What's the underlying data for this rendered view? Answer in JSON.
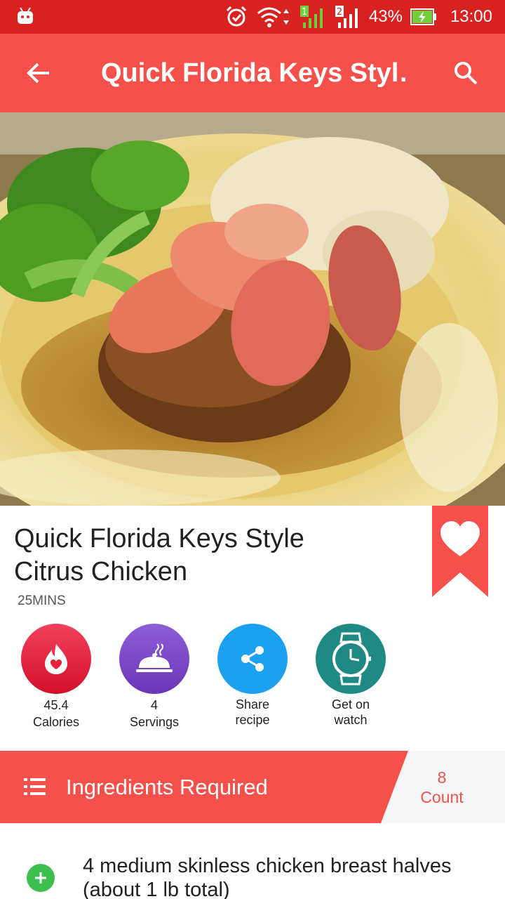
{
  "status_bar": {
    "battery": "43%",
    "time": "13:00",
    "sim1": "1",
    "sim2": "2",
    "icons": [
      "android-icon",
      "alarm-icon",
      "wifi-icon",
      "signal-icon",
      "battery-charging-icon"
    ]
  },
  "app_bar": {
    "title": "Quick Florida Keys Styl…",
    "back_icon": "arrow-back-icon",
    "search_icon": "search-icon"
  },
  "recipe": {
    "title_line1": "Quick Florida Keys Style",
    "title_line2": "Citrus Chicken",
    "time": "25MINS"
  },
  "actions": [
    {
      "value": "45.4",
      "label": "Calories",
      "icon": "flame-heart-icon",
      "color": "#e8203a"
    },
    {
      "value": "4",
      "label": "Servings",
      "icon": "cloche-icon",
      "color": "#7a48c8"
    },
    {
      "value": "Share",
      "label": "recipe",
      "icon": "share-icon",
      "color": "#1ca1f1"
    },
    {
      "value": "Get on",
      "label": "watch",
      "icon": "watch-icon",
      "color": "#1f8a83"
    }
  ],
  "ingredients": {
    "title": "Ingredients Required",
    "count": "8",
    "count_label": "Count",
    "items": [
      {
        "line1": "4 medium skinless chicken breast halves",
        "line2": "(about 1 lb total)"
      }
    ]
  },
  "colors": {
    "status_bar": "#d7221f",
    "app_bar": "#f6504b",
    "plus": "#3cbf4e"
  }
}
